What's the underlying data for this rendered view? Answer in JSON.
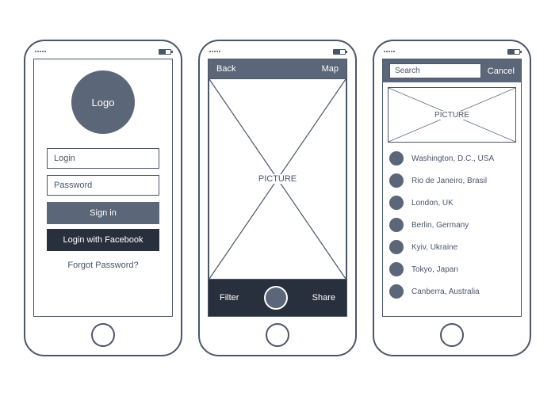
{
  "screen1": {
    "logo_text": "Logo",
    "login_placeholder": "Login",
    "password_placeholder": "Password",
    "signin_label": "Sign in",
    "facebook_label": "Login with Facebook",
    "forgot_label": "Forgot Password?"
  },
  "screen2": {
    "back_label": "Back",
    "map_label": "Map",
    "picture_label": "PICTURE",
    "filter_label": "Filter",
    "share_label": "Share"
  },
  "screen3": {
    "search_placeholder": "Search",
    "cancel_label": "Cancel",
    "picture_label": "PICTURE",
    "items": [
      "Washington, D.C., USA",
      "Rio de Janeiro, Brasil",
      "London, UK",
      "Berlin, Germany",
      "Kyiv, Ukraine",
      "Tokyo, Japan",
      "Canberra, Australia"
    ]
  }
}
